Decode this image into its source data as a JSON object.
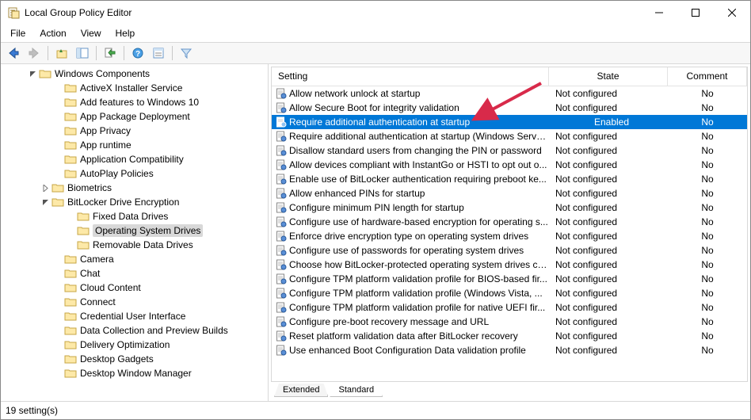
{
  "window": {
    "title": "Local Group Policy Editor"
  },
  "menu": {
    "file": "File",
    "action": "Action",
    "view": "View",
    "help": "Help"
  },
  "tree": {
    "items": [
      {
        "indent": 2,
        "exp": "v",
        "label": "Windows Components"
      },
      {
        "indent": 4,
        "exp": "",
        "label": "ActiveX Installer Service"
      },
      {
        "indent": 4,
        "exp": "",
        "label": "Add features to Windows 10"
      },
      {
        "indent": 4,
        "exp": "",
        "label": "App Package Deployment"
      },
      {
        "indent": 4,
        "exp": "",
        "label": "App Privacy"
      },
      {
        "indent": 4,
        "exp": "",
        "label": "App runtime"
      },
      {
        "indent": 4,
        "exp": "",
        "label": "Application Compatibility"
      },
      {
        "indent": 4,
        "exp": "",
        "label": "AutoPlay Policies"
      },
      {
        "indent": 3,
        "exp": ">",
        "label": "Biometrics"
      },
      {
        "indent": 3,
        "exp": "v",
        "label": "BitLocker Drive Encryption"
      },
      {
        "indent": 5,
        "exp": "",
        "label": "Fixed Data Drives"
      },
      {
        "indent": 5,
        "exp": "",
        "label": "Operating System Drives",
        "selected": true
      },
      {
        "indent": 5,
        "exp": "",
        "label": "Removable Data Drives"
      },
      {
        "indent": 4,
        "exp": "",
        "label": "Camera"
      },
      {
        "indent": 4,
        "exp": "",
        "label": "Chat"
      },
      {
        "indent": 4,
        "exp": "",
        "label": "Cloud Content"
      },
      {
        "indent": 4,
        "exp": "",
        "label": "Connect"
      },
      {
        "indent": 4,
        "exp": "",
        "label": "Credential User Interface"
      },
      {
        "indent": 4,
        "exp": "",
        "label": "Data Collection and Preview Builds"
      },
      {
        "indent": 4,
        "exp": "",
        "label": "Delivery Optimization"
      },
      {
        "indent": 4,
        "exp": "",
        "label": "Desktop Gadgets"
      },
      {
        "indent": 4,
        "exp": "",
        "label": "Desktop Window Manager"
      }
    ]
  },
  "columns": {
    "setting": "Setting",
    "state": "State",
    "comment": "Comment"
  },
  "policies": [
    {
      "name": "Allow network unlock at startup",
      "state": "Not configured",
      "comment": "No"
    },
    {
      "name": "Allow Secure Boot for integrity validation",
      "state": "Not configured",
      "comment": "No"
    },
    {
      "name": "Require additional authentication at startup",
      "state": "Enabled",
      "comment": "No",
      "selected": true
    },
    {
      "name": "Require additional authentication at startup (Windows Serve...",
      "state": "Not configured",
      "comment": "No"
    },
    {
      "name": "Disallow standard users from changing the PIN or password",
      "state": "Not configured",
      "comment": "No"
    },
    {
      "name": "Allow devices compliant with InstantGo or HSTI to opt out o...",
      "state": "Not configured",
      "comment": "No"
    },
    {
      "name": "Enable use of BitLocker authentication requiring preboot ke...",
      "state": "Not configured",
      "comment": "No"
    },
    {
      "name": "Allow enhanced PINs for startup",
      "state": "Not configured",
      "comment": "No"
    },
    {
      "name": "Configure minimum PIN length for startup",
      "state": "Not configured",
      "comment": "No"
    },
    {
      "name": "Configure use of hardware-based encryption for operating s...",
      "state": "Not configured",
      "comment": "No"
    },
    {
      "name": "Enforce drive encryption type on operating system drives",
      "state": "Not configured",
      "comment": "No"
    },
    {
      "name": "Configure use of passwords for operating system drives",
      "state": "Not configured",
      "comment": "No"
    },
    {
      "name": "Choose how BitLocker-protected operating system drives ca...",
      "state": "Not configured",
      "comment": "No"
    },
    {
      "name": "Configure TPM platform validation profile for BIOS-based fir...",
      "state": "Not configured",
      "comment": "No"
    },
    {
      "name": "Configure TPM platform validation profile (Windows Vista, ...",
      "state": "Not configured",
      "comment": "No"
    },
    {
      "name": "Configure TPM platform validation profile for native UEFI fir...",
      "state": "Not configured",
      "comment": "No"
    },
    {
      "name": "Configure pre-boot recovery message and URL",
      "state": "Not configured",
      "comment": "No"
    },
    {
      "name": "Reset platform validation data after BitLocker recovery",
      "state": "Not configured",
      "comment": "No"
    },
    {
      "name": "Use enhanced Boot Configuration Data validation profile",
      "state": "Not configured",
      "comment": "No"
    }
  ],
  "tabs": {
    "extended": "Extended",
    "standard": "Standard"
  },
  "status": {
    "text": "19 setting(s)"
  }
}
